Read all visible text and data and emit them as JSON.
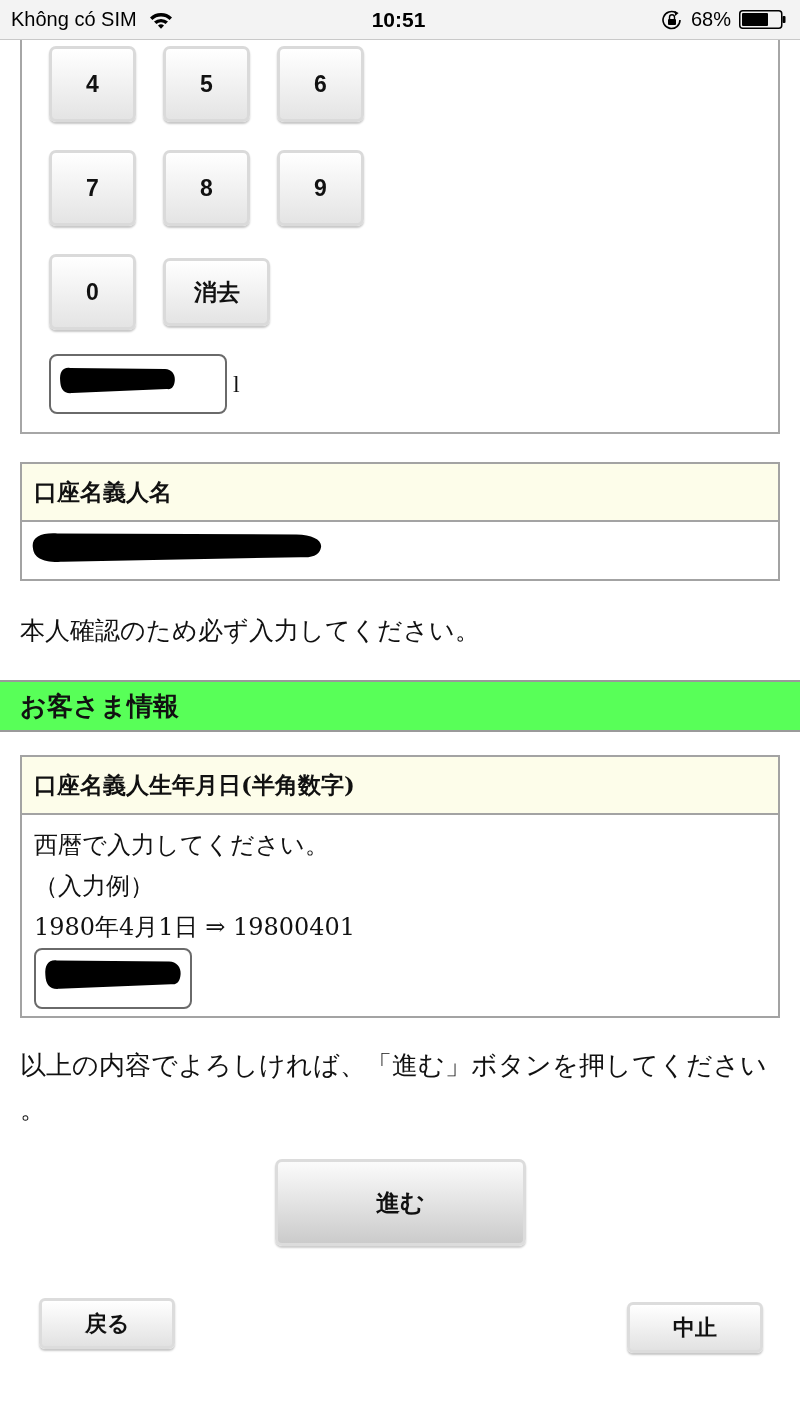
{
  "status_bar": {
    "carrier": "Không có SIM",
    "time": "10:51",
    "battery": "68%"
  },
  "keypad": {
    "rows": [
      [
        {
          "label": "4",
          "kind": "digit"
        },
        {
          "label": "5",
          "kind": "digit"
        },
        {
          "label": "6",
          "kind": "digit"
        }
      ],
      [
        {
          "label": "7",
          "kind": "digit"
        },
        {
          "label": "8",
          "kind": "digit"
        },
        {
          "label": "9",
          "kind": "digit"
        }
      ],
      [
        {
          "label": "0",
          "kind": "digit"
        },
        {
          "label": "消去",
          "kind": "clear"
        }
      ]
    ],
    "input_suffix": "l"
  },
  "account_holder": {
    "heading": "口座名義人名"
  },
  "notice": "本人確認のため必ず入力してください。",
  "section": {
    "title": "お客さま情報"
  },
  "birth_date": {
    "heading": "口座名義人生年月日(半角数字)",
    "instructions": [
      "西暦で入力してください。",
      "（入力例）",
      "1980年4月1日 ⇒ 19800401"
    ]
  },
  "confirm_text": "以上の内容でよろしければ、「進む」ボタンを押してください。",
  "buttons": {
    "next": "進む",
    "back": "戻る",
    "cancel": "中止"
  }
}
